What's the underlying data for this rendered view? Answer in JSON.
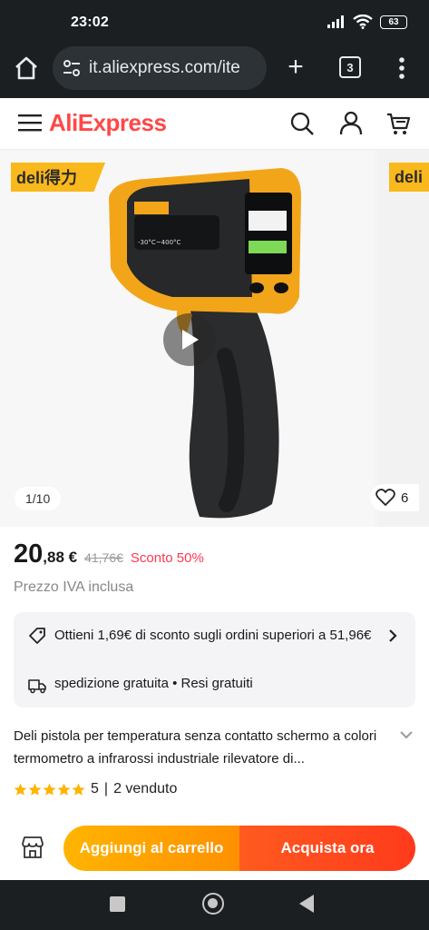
{
  "status_bar": {
    "time": "23:02",
    "battery": "63"
  },
  "browser": {
    "url": "it.aliexpress.com/ite",
    "tab_count": "3"
  },
  "site": {
    "logo": "AliExpress"
  },
  "gallery": {
    "brand_badge": "deli得力",
    "brand_badge_next": "deli",
    "image_counter": "1/10",
    "wishlist_count": "6"
  },
  "price": {
    "integer": "20",
    "decimal": ",88 €",
    "original": "41,76€",
    "discount": "Sconto 50%",
    "vat_note": "Prezzo IVA inclusa"
  },
  "promo": {
    "coupon_text": "Ottieni 1,69€ di sconto sugli ordini superiori a 51,96€",
    "shipping_text": "spedizione gratuita • Resi gratuiti"
  },
  "product": {
    "title": "Deli pistola per temperatura senza contatto schermo a colori termometro a infrarossi industriale rilevatore di...",
    "rating": "5",
    "sold": "2 venduto",
    "rating_separator": "|",
    "star_color": "#ffb400"
  },
  "actions": {
    "add_to_cart": "Aggiungi al carrello",
    "buy_now": "Acquista ora"
  },
  "colors": {
    "brand": "#ff4747",
    "add_cart": "#ffa500",
    "buy_now": "#ff4420",
    "discount": "#fd384f"
  }
}
